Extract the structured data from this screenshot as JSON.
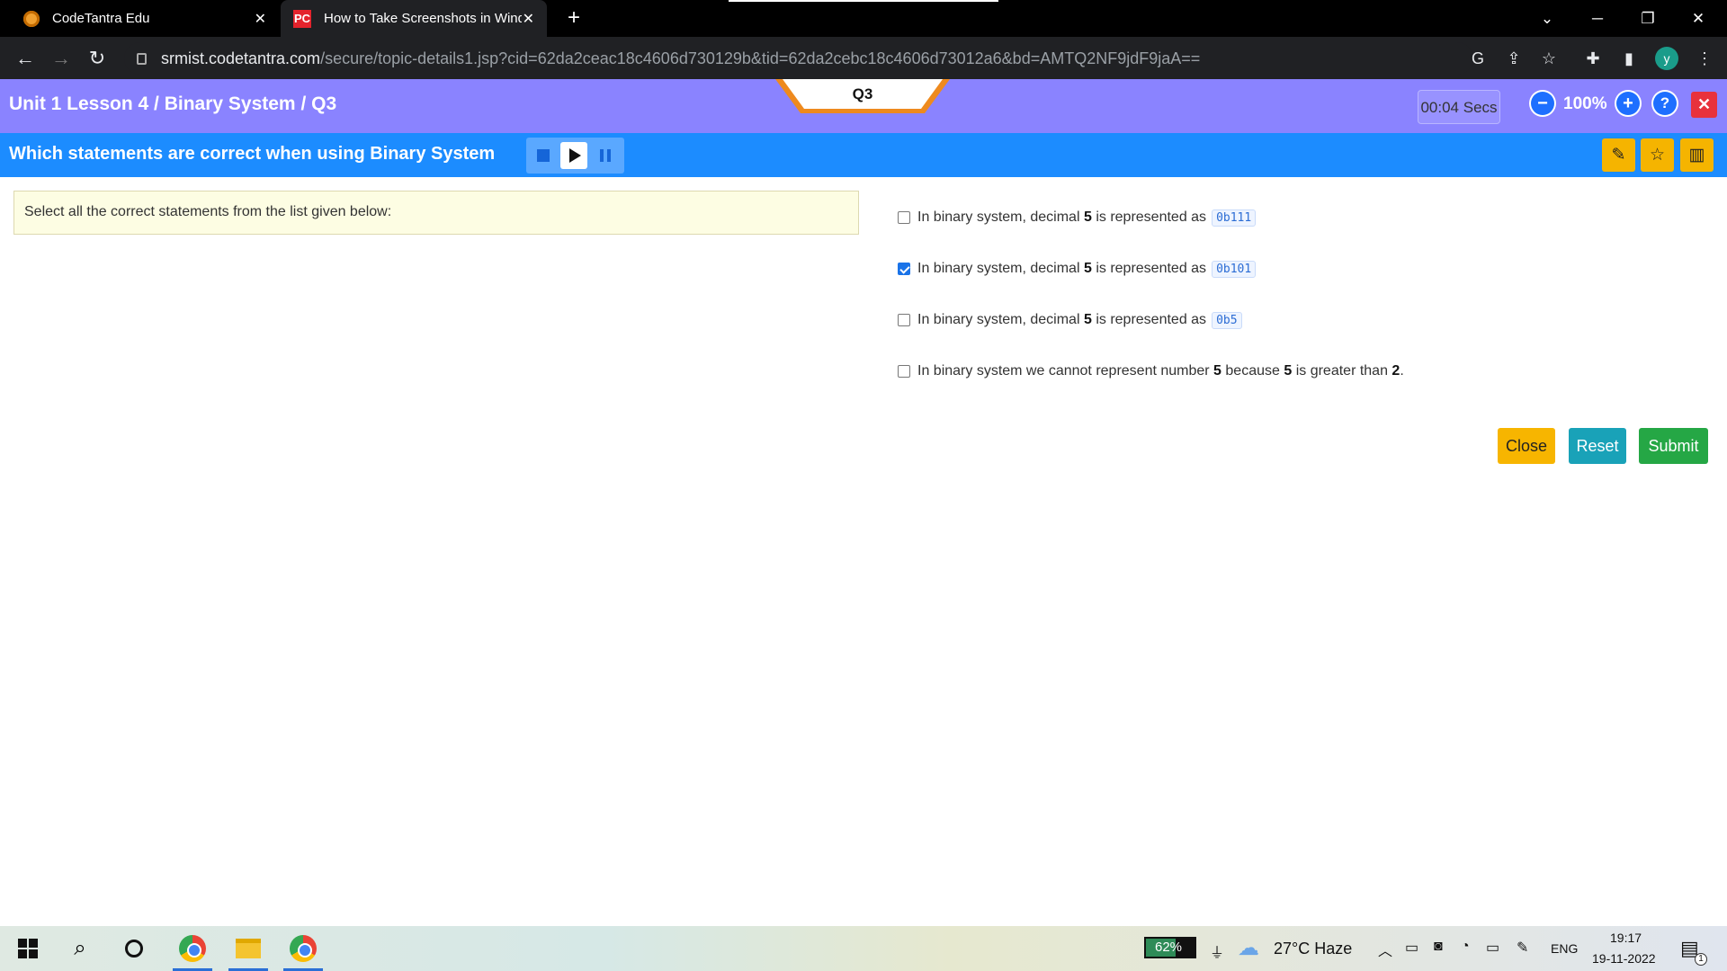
{
  "browser": {
    "tabs": [
      {
        "title": "CodeTantra Edu",
        "icon": "codetantra-favicon"
      },
      {
        "title": "How to Take Screenshots in Wind",
        "icon": "pcmag-favicon",
        "favicon_text": "PC"
      }
    ],
    "url_host": "srmist.codetantra.com",
    "url_path": "/secure/topic-details1.jsp?cid=62da2ceac18c4606d730129b&tid=62da2cebc18c4606d73012a6&bd=AMTQ2NF9jdF9jaA==",
    "profile_initial": "y"
  },
  "header": {
    "breadcrumb": "Unit 1 Lesson 4 / Binary System / Q3",
    "question_badge": "Q3",
    "timer": "00:04 Secs",
    "zoom": "100%",
    "accent_color": "#8a83ff"
  },
  "question": {
    "title": "Which statements are correct when using Binary System",
    "prompt": "Select all the correct statements from the list given below:",
    "options": [
      {
        "pre": "In binary system, decimal ",
        "bold": "5",
        "mid": " is represented as",
        "code": "0b111",
        "checked": false
      },
      {
        "pre": "In binary system, decimal ",
        "bold": "5",
        "mid": " is represented as",
        "code": "0b101",
        "checked": true
      },
      {
        "pre": "In binary system, decimal ",
        "bold": "5",
        "mid": " is represented as",
        "code": "0b5",
        "checked": false
      },
      {
        "pre": "In binary system we cannot represent number ",
        "bold": "5",
        "mid": " because ",
        "bold2": "5",
        "mid2": " is greater than ",
        "bold3": "2",
        "end": ".",
        "checked": false
      }
    ]
  },
  "actions": {
    "close": "Close",
    "reset": "Reset",
    "submit": "Submit"
  },
  "taskbar": {
    "battery": "62%",
    "battery_fraction": 0.62,
    "weather": "27°C  Haze",
    "language": "ENG",
    "time": "19:17",
    "date": "19-11-2022",
    "notifications": "1"
  }
}
